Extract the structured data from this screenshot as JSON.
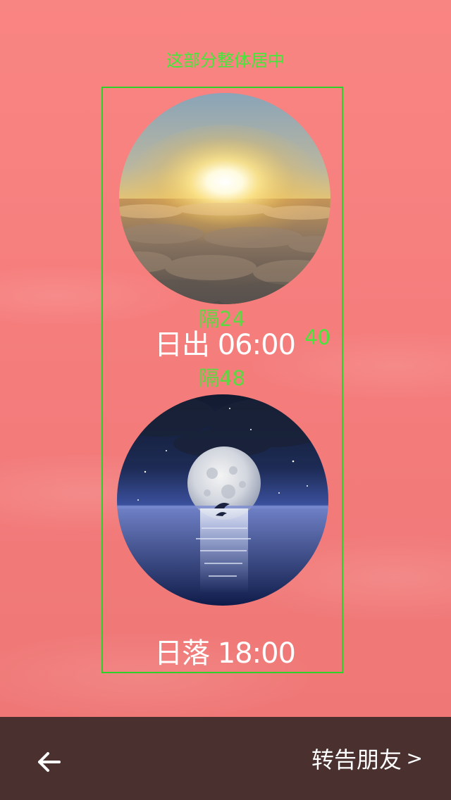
{
  "annotations": {
    "center_note": "这部分整体居中",
    "gap_top": "隔24",
    "size_note": "40",
    "gap_bottom": "隔48"
  },
  "sunrise": {
    "label": "日出 06:00"
  },
  "sunset": {
    "label": "日落 18:00"
  },
  "bottom_bar": {
    "share_label": "转告朋友",
    "share_chevron": ">"
  },
  "colors": {
    "background": "#f47d7c",
    "annotation": "#42e83a",
    "frame": "#2ed12a",
    "bottom_bar": "#4a3130",
    "text": "#ffffff"
  },
  "icons": {
    "back": "back-arrow-icon",
    "forward": "chevron-right-icon"
  }
}
